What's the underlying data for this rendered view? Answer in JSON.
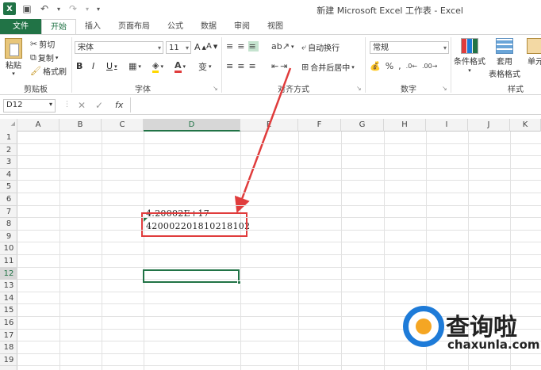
{
  "window": {
    "title": "新建 Microsoft Excel 工作表 - Excel"
  },
  "tabs": [
    "文件",
    "开始",
    "插入",
    "页面布局",
    "公式",
    "数据",
    "审阅",
    "视图"
  ],
  "ribbon": {
    "clipboard": {
      "paste": "粘贴",
      "cut": "剪切",
      "copy": "复制",
      "format_painter": "格式刷",
      "label": "剪贴板"
    },
    "font": {
      "name": "宋体",
      "size": "11",
      "grow": "A",
      "shrink": "A",
      "bold": "B",
      "italic": "I",
      "underline": "U",
      "label": "字体",
      "wen": "变"
    },
    "alignment": {
      "wrap": "自动换行",
      "merge": "合并后居中",
      "label": "对齐方式"
    },
    "number": {
      "format": "常规",
      "label": "数字"
    },
    "styles": {
      "conditional": "条件格式",
      "table_format_1": "套用",
      "table_format_2": "表格格式",
      "cell_styles": "单元",
      "label": "样式"
    }
  },
  "formula_bar": {
    "name_box": "D12",
    "fx": "fx",
    "cancel": "✕",
    "enter": "✓",
    "value": ""
  },
  "columns": [
    "A",
    "B",
    "C",
    "D",
    "E",
    "F",
    "G",
    "H",
    "I",
    "J",
    "K"
  ],
  "rows": [
    "1",
    "2",
    "3",
    "4",
    "5",
    "6",
    "7",
    "8",
    "9",
    "10",
    "11",
    "12",
    "13",
    "14",
    "15",
    "16",
    "17",
    "18",
    "19"
  ],
  "cells": {
    "D7": "4.20002E+17",
    "D8": "420002201810218102"
  },
  "selected": {
    "cell": "D12",
    "column": "D",
    "row": "12"
  },
  "watermark": {
    "brand": "查询啦",
    "url": "chaxunla.com"
  },
  "colors": {
    "accent": "#217346",
    "annotation": "#e03c3c",
    "watermark_blue": "#1e7bd8"
  }
}
